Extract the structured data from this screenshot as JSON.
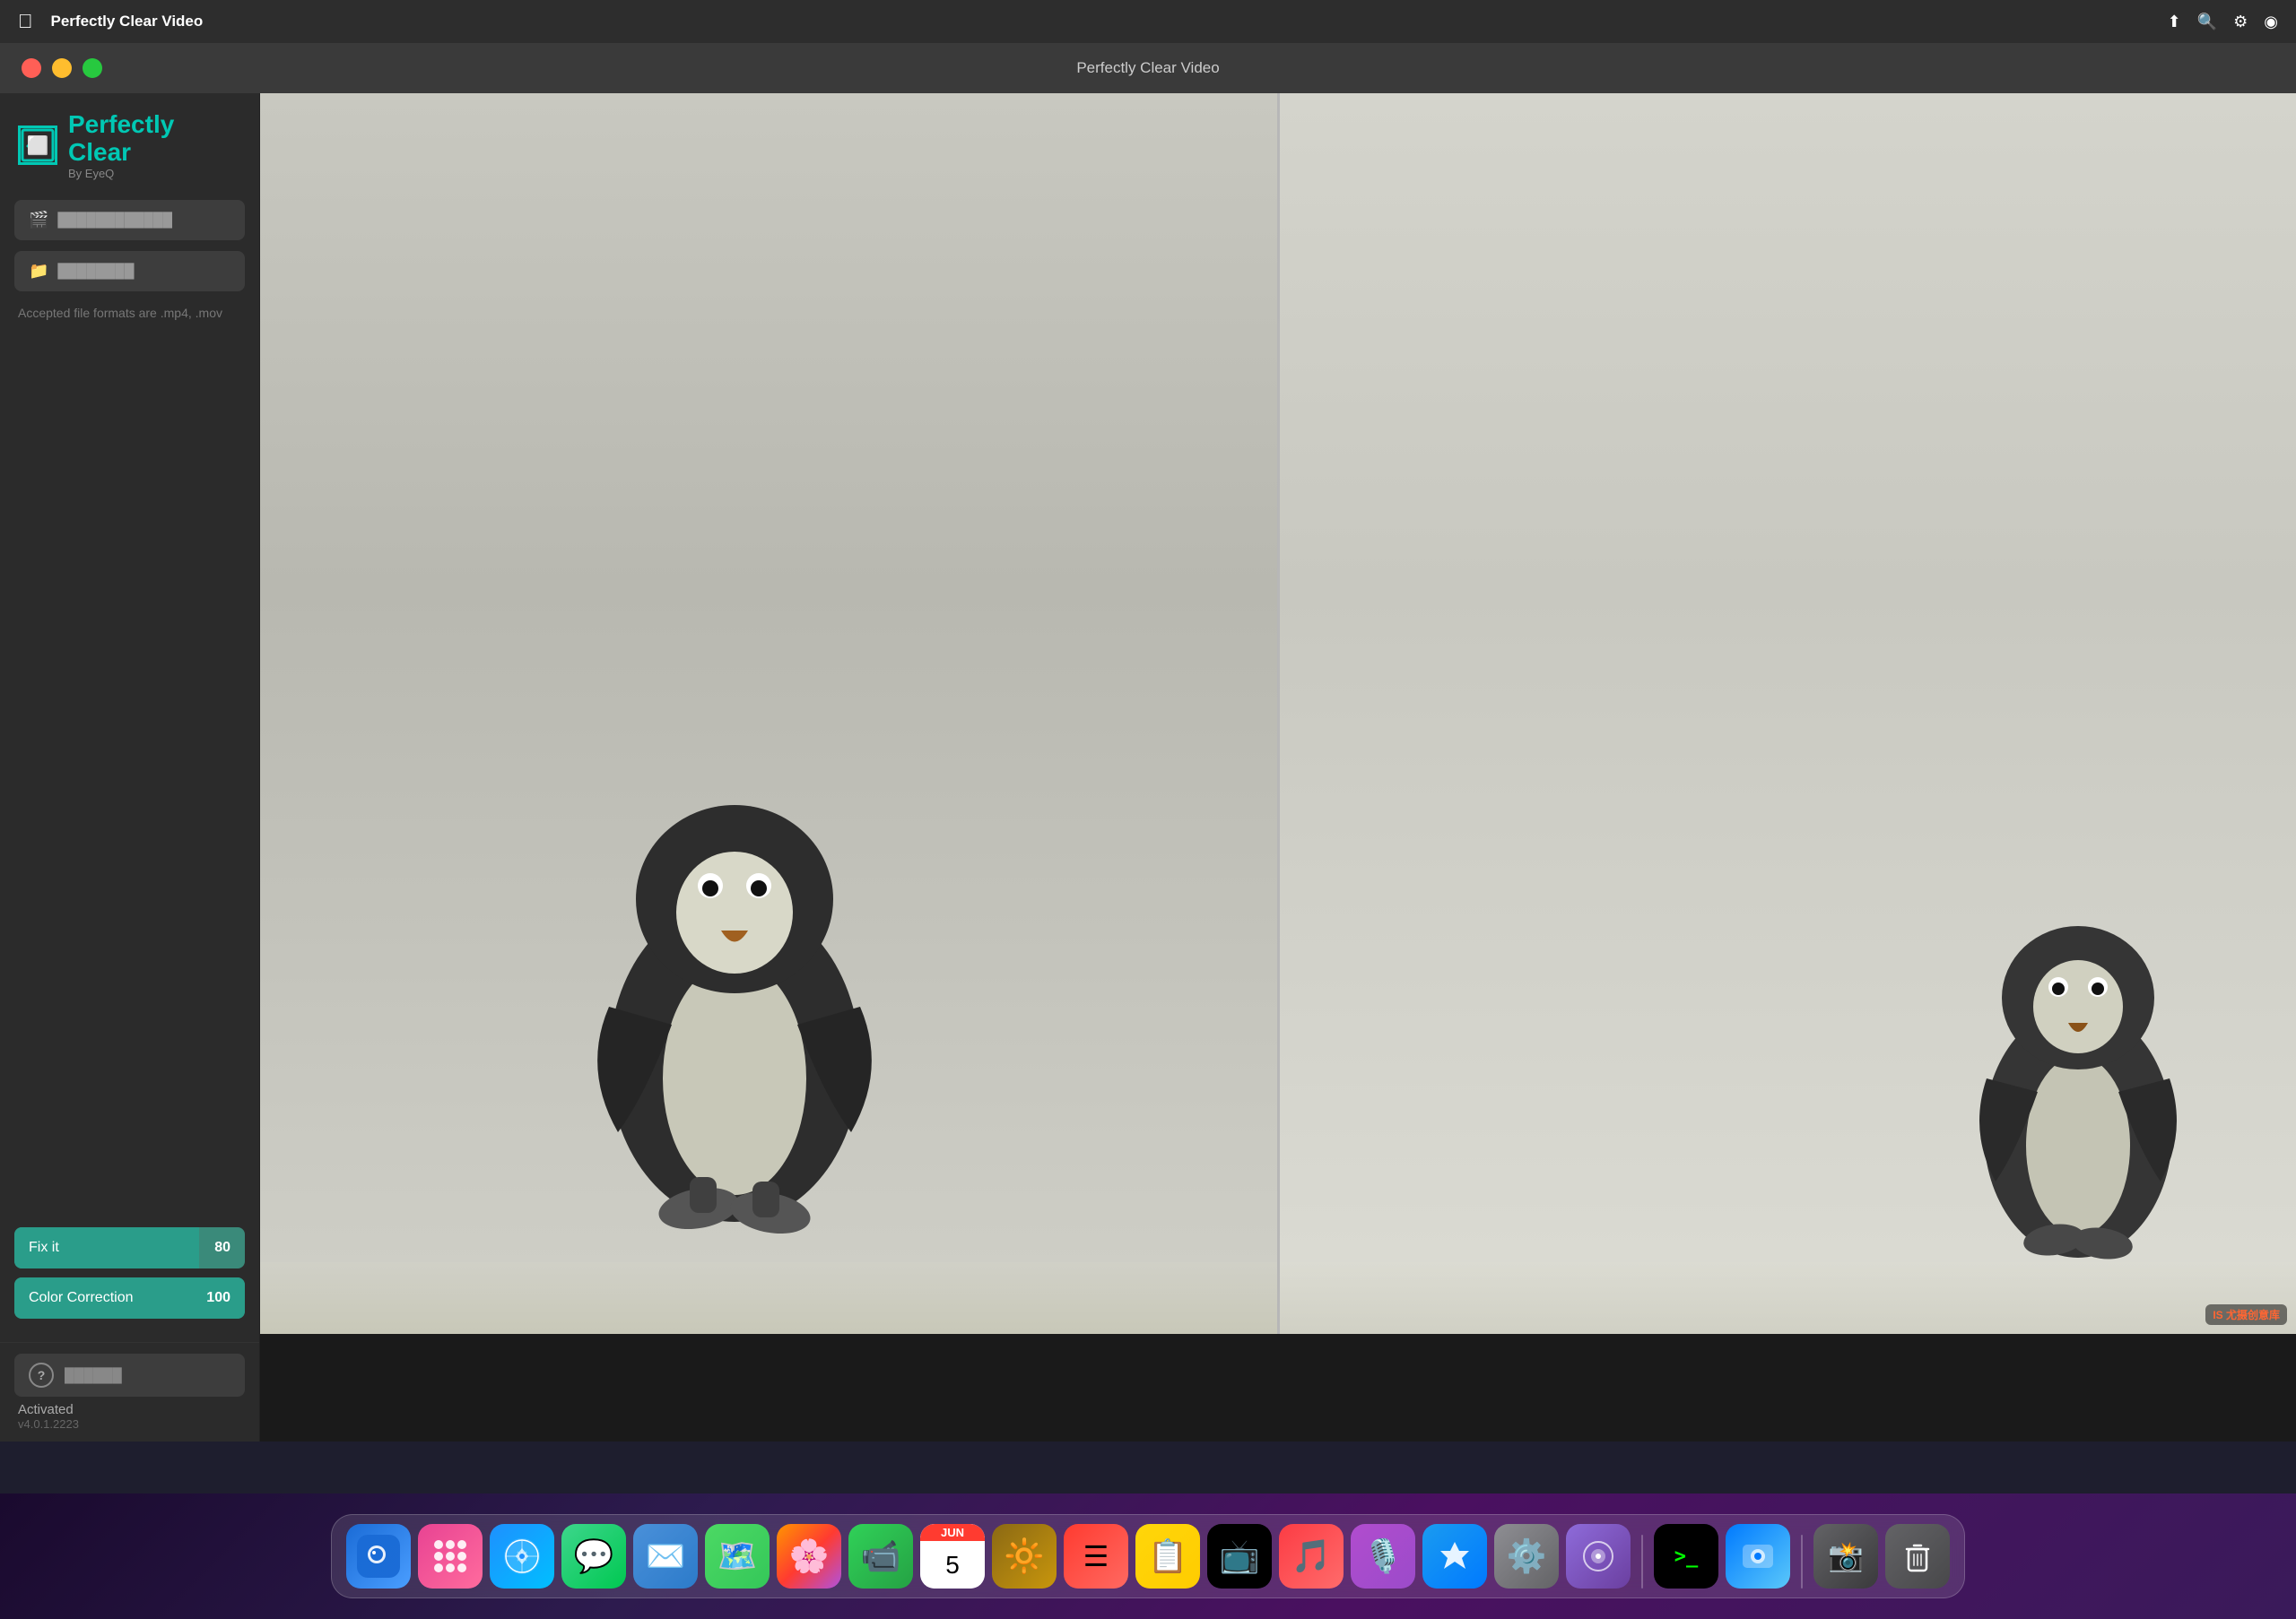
{
  "menubar": {
    "apple_label": "",
    "app_name": "Perfectly Clear Video",
    "title": "Perfectly Clear Video"
  },
  "window": {
    "title": "Perfectly Clear Video",
    "controls": {
      "close": "close",
      "minimize": "minimize",
      "maximize": "maximize"
    }
  },
  "sidebar": {
    "logo": {
      "main": "Perfectly Clear",
      "sub": "By EyeQ"
    },
    "input_video_label": "Input Video",
    "output_folder_label": "Output Folder",
    "file_hint": "Accepted file formats are .mp4, .mov",
    "sliders": [
      {
        "label": "Fix it",
        "value": 80,
        "fill_pct": 80
      },
      {
        "label": "Color Correction",
        "value": 100,
        "fill_pct": 100
      }
    ],
    "help_label": "Help & License",
    "activated_label": "Activated",
    "version_label": "v4.0.1.2223"
  },
  "video": {
    "placeholder": "Penguin video preview"
  },
  "dock": {
    "items": [
      {
        "name": "finder",
        "emoji": "🖥",
        "label": "Finder"
      },
      {
        "name": "grid",
        "emoji": "⬡",
        "label": "Launchpad"
      },
      {
        "name": "safari",
        "emoji": "🧭",
        "label": "Safari"
      },
      {
        "name": "messages",
        "emoji": "💬",
        "label": "Messages"
      },
      {
        "name": "mail",
        "emoji": "✉",
        "label": "Mail"
      },
      {
        "name": "maps",
        "emoji": "🗺",
        "label": "Maps"
      },
      {
        "name": "photos",
        "emoji": "🌸",
        "label": "Photos"
      },
      {
        "name": "facetime",
        "emoji": "📹",
        "label": "FaceTime"
      },
      {
        "name": "calendar",
        "month": "JUN",
        "day": "5",
        "label": "Calendar"
      },
      {
        "name": "finder2",
        "emoji": "🔆",
        "label": "Finder"
      },
      {
        "name": "reminders",
        "emoji": "☰",
        "label": "Reminders"
      },
      {
        "name": "notes",
        "emoji": "📋",
        "label": "Notes"
      },
      {
        "name": "appletv",
        "emoji": "📺",
        "label": "Apple TV"
      },
      {
        "name": "music",
        "emoji": "🎵",
        "label": "Music"
      },
      {
        "name": "podcasts",
        "emoji": "🎙",
        "label": "Podcasts"
      },
      {
        "name": "appstore",
        "emoji": "🅰",
        "label": "App Store"
      },
      {
        "name": "settings",
        "emoji": "⚙",
        "label": "System Preferences"
      },
      {
        "name": "instruments",
        "emoji": "◈",
        "label": "Instruments"
      },
      {
        "name": "terminal",
        "emoji": ">_",
        "label": "Terminal"
      },
      {
        "name": "screenrecord",
        "emoji": "⬛",
        "label": "Screen Recording"
      },
      {
        "name": "misc",
        "emoji": "📸",
        "label": "Screenshot"
      },
      {
        "name": "trash",
        "emoji": "🗑",
        "label": "Trash"
      }
    ],
    "corner_label": "尤摄创意库",
    "watermark_label": "IS 尤摄创意库"
  }
}
